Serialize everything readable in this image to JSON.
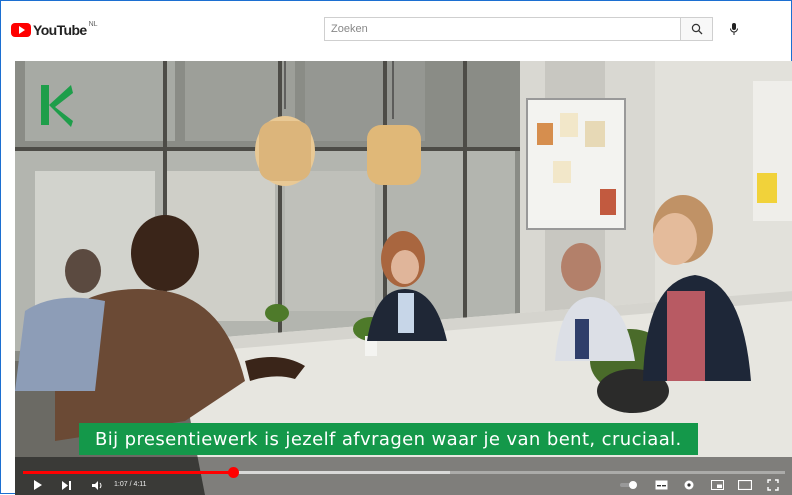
{
  "header": {
    "logo_text": "YouTube",
    "country_code": "NL",
    "search_placeholder": "Zoeken"
  },
  "video": {
    "subtitle": "Bij presentiewerk is jezelf afvragen waar je van bent, cruciaal.",
    "time_display": "1:07 / 4:11",
    "progress_played": 0.276,
    "progress_buffered": 0.56
  },
  "colors": {
    "accent_red": "#ff0000",
    "subtitle_green": "#14984a",
    "frame_blue": "#1c6fd1"
  },
  "icons": [
    "youtube-logo-icon",
    "search-icon",
    "mic-icon",
    "play-icon",
    "next-icon",
    "volume-icon",
    "autoplay-toggle-icon",
    "subtitles-icon",
    "settings-icon",
    "miniplayer-icon",
    "theater-icon",
    "fullscreen-icon"
  ]
}
